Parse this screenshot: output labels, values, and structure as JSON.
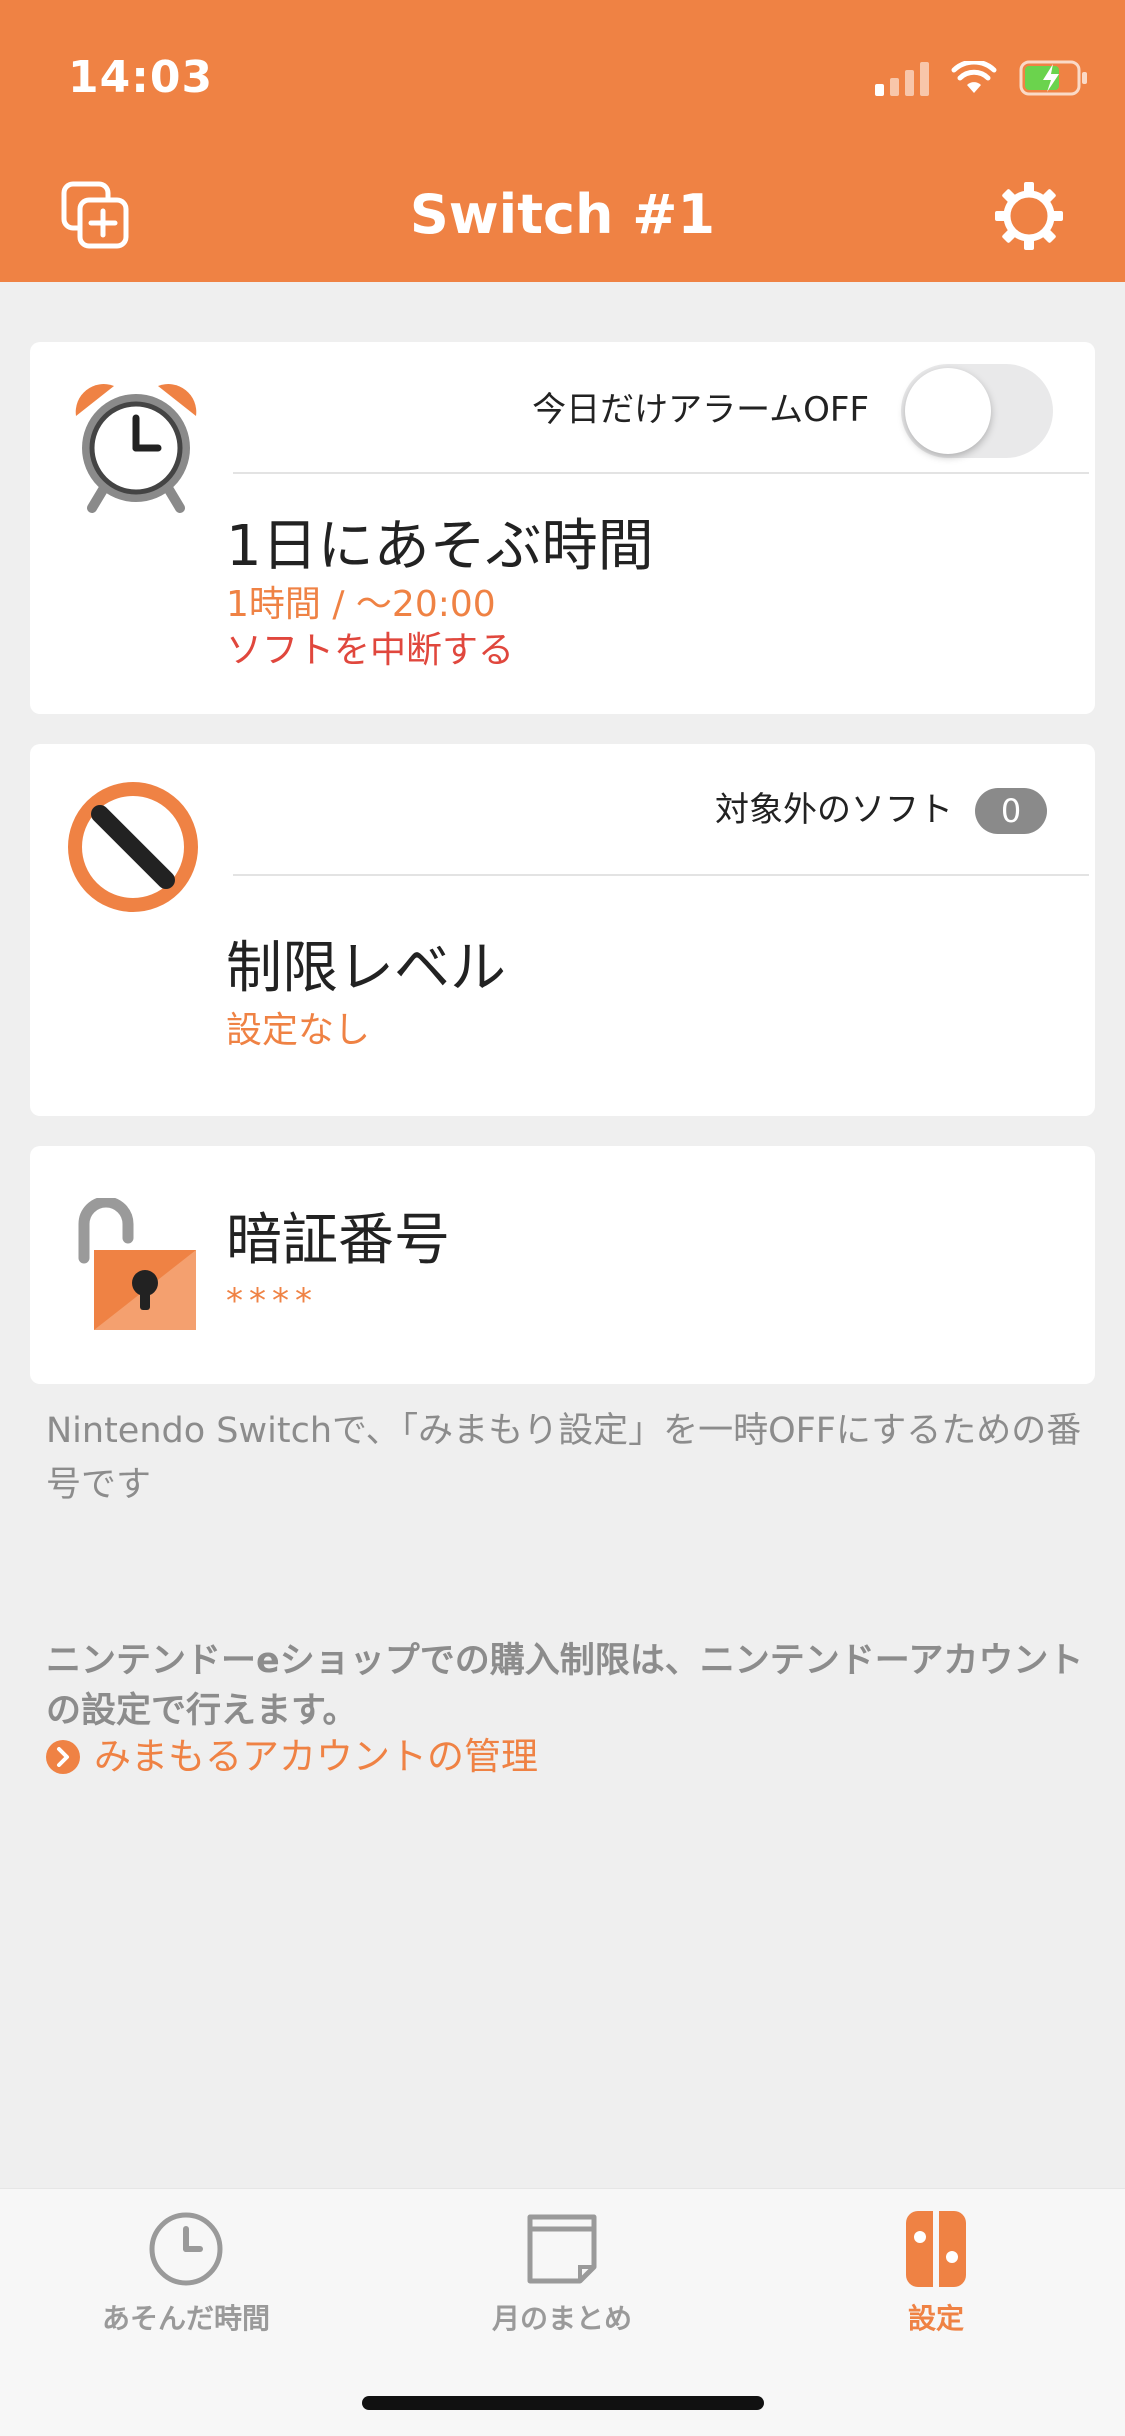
{
  "status_bar": {
    "time": "14:03"
  },
  "nav": {
    "title": "Switch #1"
  },
  "alarm_card": {
    "alarm_off_label": "今日だけアラームOFF",
    "alarm_off_enabled": false,
    "title": "1日にあそぶ時間",
    "time_value": "1時間 / 〜20:00",
    "action": "ソフトを中断する"
  },
  "restriction_card": {
    "excluded_label": "対象外のソフト",
    "excluded_count": "0",
    "title": "制限レベル",
    "value": "設定なし"
  },
  "pin_card": {
    "title": "暗証番号",
    "value": "****"
  },
  "notes": {
    "pin_note": "Nintendo Switchで、「みまもり設定」を一時OFFにするための番号です",
    "eshop_note": "ニンテンドーeショップでの購入制限は、ニンテンドーアカウントの設定で行えます。",
    "account_link": "みまもるアカウントの管理"
  },
  "tabs": [
    {
      "label": "あそんだ時間",
      "icon": "clock-icon",
      "active": false
    },
    {
      "label": "月のまとめ",
      "icon": "calendar-icon",
      "active": false
    },
    {
      "label": "設定",
      "icon": "switch-console-icon",
      "active": true
    }
  ],
  "colors": {
    "accent": "#ef8244",
    "warning": "#e0473d",
    "background": "#efefef"
  }
}
